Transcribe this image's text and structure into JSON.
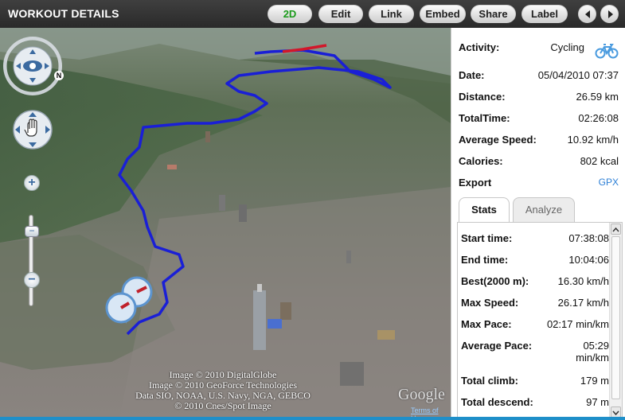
{
  "header": {
    "title": "WORKOUT DETAILS",
    "buttons": {
      "view_2d": "2D",
      "edit": "Edit",
      "link": "Link",
      "embed": "Embed",
      "share": "Share",
      "label": "Label"
    },
    "active_color": "#1a9a1a"
  },
  "map": {
    "credits": [
      "Image © 2010 DigitalGlobe",
      "Image © 2010 GeoForce Technologies",
      "Data SIO, NOAA, U.S. Navy, NGA, GEBCO",
      "© 2010 Cnes/Spot Image"
    ],
    "logo": "Google",
    "terms": "Terms of Use",
    "route_color": "#1a1fd6",
    "segment_color": "#d2172a"
  },
  "summary": {
    "activity": {
      "label": "Activity:",
      "value": "Cycling",
      "icon": "bicycle-icon"
    },
    "date": {
      "label": "Date:",
      "value": "05/04/2010 07:37"
    },
    "distance": {
      "label": "Distance:",
      "value": "26.59 km"
    },
    "total_time": {
      "label": "TotalTime:",
      "value": "02:26:08"
    },
    "avg_speed": {
      "label": "Average Speed:",
      "value": "10.92 km/h"
    },
    "calories": {
      "label": "Calories:",
      "value": "802 kcal"
    },
    "export": {
      "label": "Export",
      "value": "GPX"
    }
  },
  "tabs": {
    "stats": "Stats",
    "analyze": "Analyze"
  },
  "stats": {
    "start_time": {
      "label": "Start time:",
      "value": "07:38:08"
    },
    "end_time": {
      "label": "End time:",
      "value": "10:04:06"
    },
    "best": {
      "label": "Best(2000 m):",
      "value": "16.30 km/h"
    },
    "max_speed": {
      "label": "Max Speed:",
      "value": "26.17 km/h"
    },
    "max_pace": {
      "label": "Max Pace:",
      "value": "02:17 min/km"
    },
    "avg_pace": {
      "label": "Average Pace:",
      "value_line1": "05:29",
      "value_line2": "min/km"
    },
    "total_climb": {
      "label": "Total climb:",
      "value": "179 m"
    },
    "total_descend": {
      "label": "Total descend:",
      "value": "97 m"
    }
  }
}
